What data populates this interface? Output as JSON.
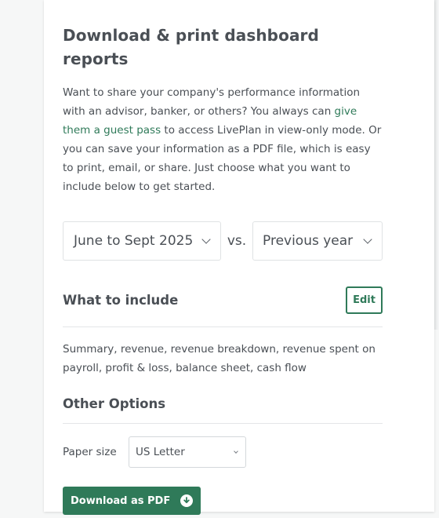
{
  "page": {
    "title": "Download & print dashboard reports",
    "intro": {
      "before_link": "Want to share your company's performance information with an advisor, banker, or others? You always can ",
      "link": "give them a guest pass",
      "after_link": " to access LivePlan in view-only mode. Or you can save your information as a PDF file, which is easy to print, email, or share. Just choose what you want to include below to get started."
    }
  },
  "period": {
    "selected": "June to Sept 2025",
    "vs_label": "vs.",
    "comparison": "Previous year"
  },
  "include": {
    "heading": "What to include",
    "edit_label": "Edit",
    "summary": "Summary, revenue, revenue breakdown, revenue spent on payroll, profit & loss, balance sheet, cash flow"
  },
  "options": {
    "heading": "Other Options",
    "paper_label": "Paper size",
    "paper_value": "US Letter"
  },
  "actions": {
    "download_label": "Download as PDF"
  },
  "colors": {
    "accent": "#2f7a59",
    "text": "#4a4f55",
    "border": "#dfe2e4"
  },
  "icons": {
    "select_caret": "chevron-down-icon",
    "download": "download-circle-icon"
  }
}
